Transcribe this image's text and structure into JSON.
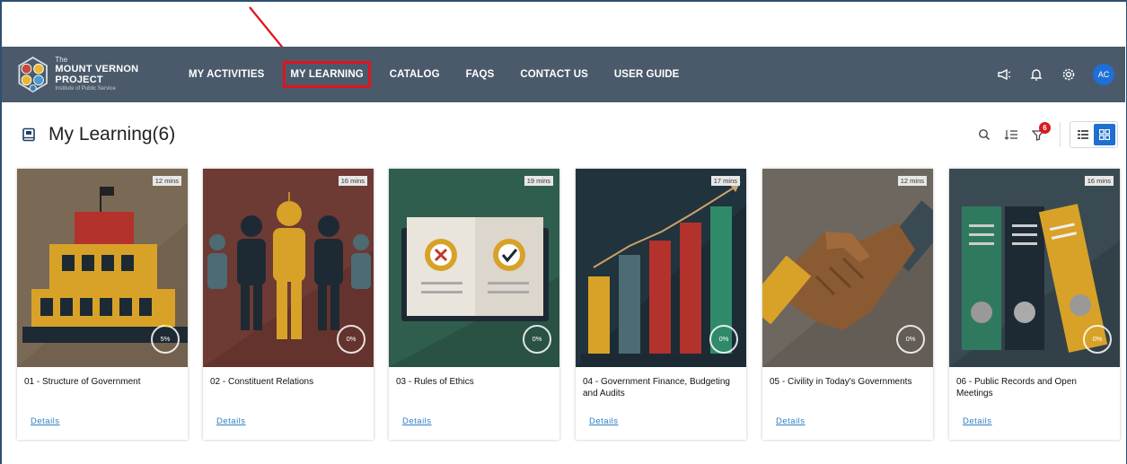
{
  "nav": {
    "logo_the": "The",
    "logo_name": "MOUNT VERNON PROJECT",
    "logo_sub": "Institute of Public Service",
    "items": [
      {
        "label": "MY ACTIVITIES",
        "name": "nav-my-activities"
      },
      {
        "label": "MY LEARNING",
        "name": "nav-my-learning",
        "active": true
      },
      {
        "label": "CATALOG",
        "name": "nav-catalog"
      },
      {
        "label": "FAQS",
        "name": "nav-faqs"
      },
      {
        "label": "CONTACT US",
        "name": "nav-contact-us"
      },
      {
        "label": "USER GUIDE",
        "name": "nav-user-guide"
      }
    ],
    "avatar_initials": "AC",
    "icons": [
      "megaphone-icon",
      "bell-icon",
      "gear-icon"
    ]
  },
  "page": {
    "title": "My Learning(6)",
    "filter_badge": "6"
  },
  "courses": [
    {
      "title": "01 - Structure of Government",
      "duration": "12 mins",
      "progress_text": "5%",
      "progress": 5,
      "bg": "#7a6a55",
      "details": "Details"
    },
    {
      "title": "02 - Constituent Relations",
      "duration": "16 mins",
      "progress_text": "0%",
      "progress": 0,
      "bg": "#6e3a34",
      "details": "Details"
    },
    {
      "title": "03 - Rules of Ethics",
      "duration": "19 mins",
      "progress_text": "0%",
      "progress": 0,
      "bg": "#2f5e4f",
      "details": "Details"
    },
    {
      "title": "04 - Government Finance, Budgeting and Audits",
      "duration": "17 mins",
      "progress_text": "0%",
      "progress": 0,
      "bg": "#21333d",
      "details": "Details"
    },
    {
      "title": "05 - Civility in Today's Governments",
      "duration": "12 mins",
      "progress_text": "0%",
      "progress": 0,
      "bg": "#6e6760",
      "details": "Details"
    },
    {
      "title": "06 - Public Records and Open Meetings",
      "duration": "16 mins",
      "progress_text": "0%",
      "progress": 0,
      "bg": "#3a4a52",
      "details": "Details"
    }
  ],
  "colors": {
    "navbar": "#4a5a6b",
    "accent": "#1f6fd0",
    "highlight": "#e0141b",
    "link": "#2f7fc6"
  }
}
